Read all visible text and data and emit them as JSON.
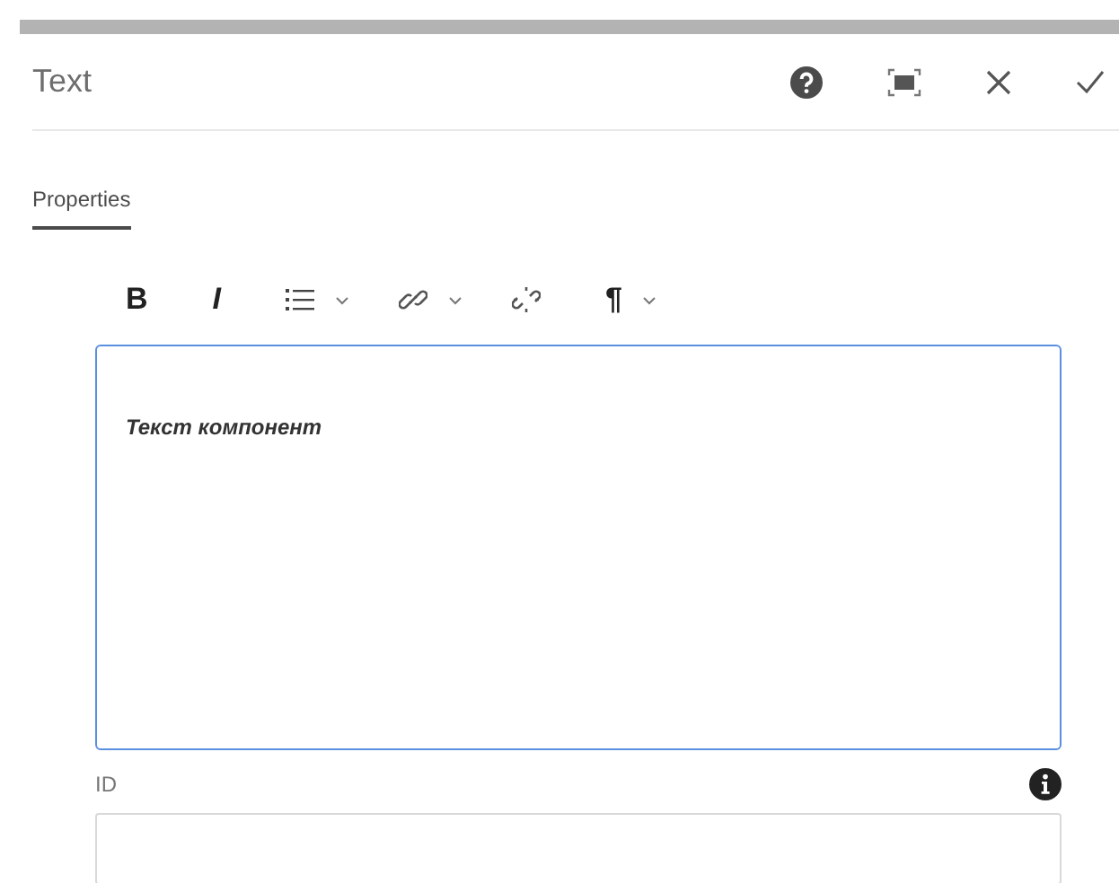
{
  "dialog": {
    "title": "Text"
  },
  "tabs": [
    {
      "label": "Properties",
      "selected": true
    }
  ],
  "toolbar": [
    {
      "kind": "bold",
      "label": "B",
      "has_menu": false
    },
    {
      "kind": "italic",
      "label": "I",
      "has_menu": false
    },
    {
      "kind": "list",
      "has_menu": true
    },
    {
      "kind": "link",
      "has_menu": true
    },
    {
      "kind": "unlink",
      "has_menu": false
    },
    {
      "kind": "paragraph",
      "label": "¶",
      "has_menu": true
    }
  ],
  "editor": {
    "value": "Текст компонент",
    "focused": true
  },
  "fields": [
    {
      "label": "ID"
    }
  ]
}
